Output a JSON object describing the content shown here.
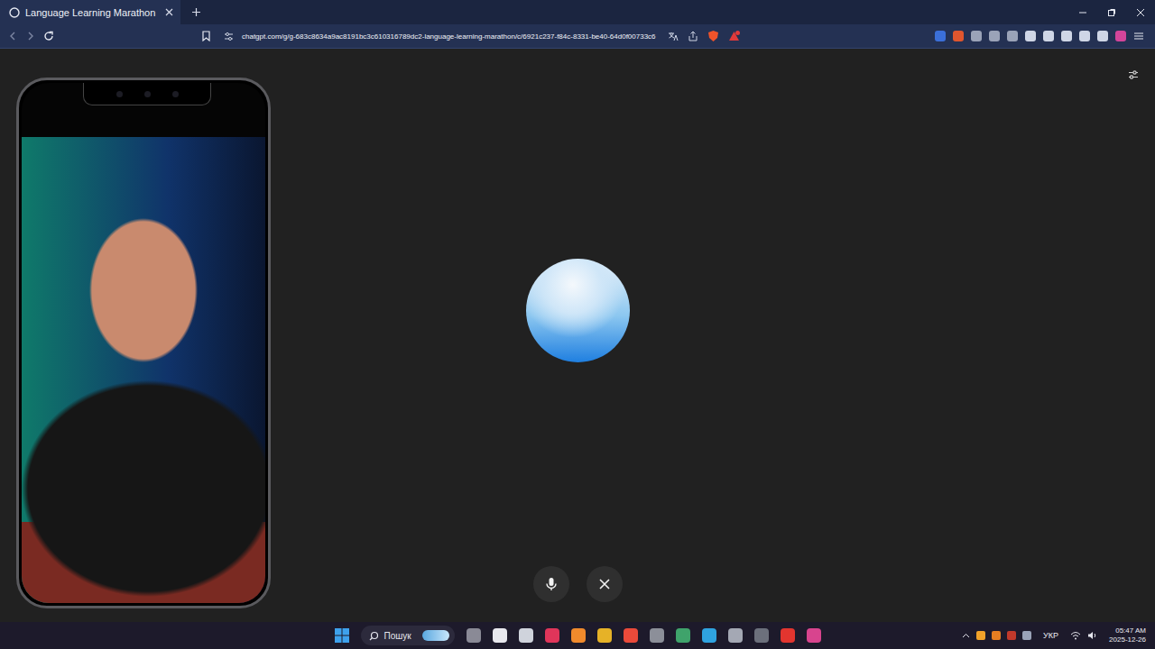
{
  "browser": {
    "tabs": [
      {
        "title": "Language Learning Marathon",
        "selected": true
      }
    ],
    "url": "chatgpt.com/g/g-683c8634a9ac8191bc3c610316789dc2-language-learning-marathon/c/6921c237-f84c-8331-be40-64d0f00733c6"
  },
  "taskbar": {
    "search_placeholder": "Пошук",
    "language": "УКР",
    "time": "05:47 AM",
    "date": "2025-12-26"
  }
}
